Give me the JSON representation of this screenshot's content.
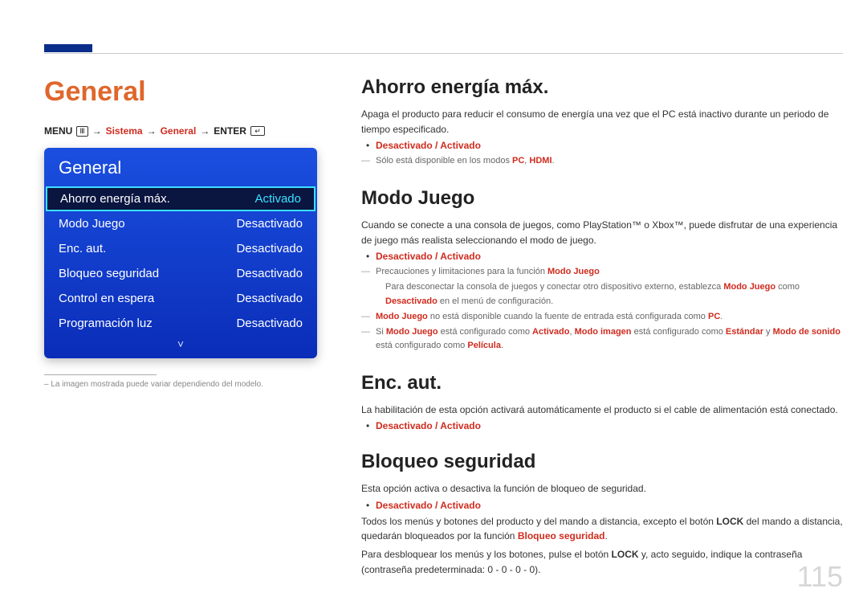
{
  "page": {
    "title": "General",
    "number": "115",
    "footnote": "La imagen mostrada puede variar dependiendo del modelo."
  },
  "breadcrumb": {
    "menu": "MENU",
    "arrow": "→",
    "sistema": "Sistema",
    "general": "General",
    "enter": "ENTER"
  },
  "osd": {
    "title": "General",
    "rows": [
      {
        "label": "Ahorro energía máx.",
        "value": "Activado",
        "selected": true
      },
      {
        "label": "Modo Juego",
        "value": "Desactivado",
        "selected": false
      },
      {
        "label": "Enc. aut.",
        "value": "Desactivado",
        "selected": false
      },
      {
        "label": "Bloqueo seguridad",
        "value": "Desactivado",
        "selected": false
      },
      {
        "label": "Control en espera",
        "value": "Desactivado",
        "selected": false
      },
      {
        "label": "Programación luz",
        "value": "Desactivado",
        "selected": false
      }
    ],
    "more": "˅"
  },
  "sections": {
    "ahorro": {
      "heading": "Ahorro energía máx.",
      "desc": "Apaga el producto para reducir el consumo de energía una vez que el PC está inactivo durante un periodo de tiempo especificado.",
      "options": "Desactivado / Activado",
      "note_prefix": "Sólo está disponible en los modos ",
      "note_pc": "PC",
      "note_sep": ", ",
      "note_hdmi": "HDMI",
      "note_suffix": "."
    },
    "modojuego": {
      "heading": "Modo Juego",
      "desc": "Cuando se conecte a una consola de juegos, como PlayStation™ o Xbox™, puede disfrutar de una experiencia de juego más realista seleccionando el modo de juego.",
      "options": "Desactivado / Activado",
      "note1_pre": "Precauciones y limitaciones para la función ",
      "note1_b": "Modo Juego",
      "sub1_pre": "Para desconectar la consola de juegos y conectar otro dispositivo externo, establezca ",
      "sub1_b1": "Modo Juego",
      "sub1_mid": " como ",
      "sub1_b2": "Desactivado",
      "sub1_post": " en el menú de configuración.",
      "note2_b1": "Modo Juego",
      "note2_mid": " no está disponible cuando la fuente de entrada está configurada como ",
      "note2_b2": "PC",
      "note2_post": ".",
      "note3_pre": "Si ",
      "note3_b1": "Modo Juego",
      "note3_m1": " está configurado como ",
      "note3_b2": "Activado",
      "note3_m2": ", ",
      "note3_b3": "Modo imagen",
      "note3_m3": " está configurado como ",
      "note3_b4": "Estándar",
      "note3_m4": " y ",
      "note3_b5": "Modo de sonido",
      "note3_m5": " está configurado como ",
      "note3_b6": "Película",
      "note3_post": "."
    },
    "encaut": {
      "heading": "Enc. aut.",
      "desc": "La habilitación de esta opción activará automáticamente el producto si el cable de alimentación está conectado.",
      "options": "Desactivado / Activado"
    },
    "bloqueo": {
      "heading": "Bloqueo seguridad",
      "desc": "Esta opción activa o desactiva la función de bloqueo de seguridad.",
      "options": "Desactivado / Activado",
      "p2_pre": "Todos los menús y botones del producto y del mando a distancia, excepto el botón ",
      "p2_b1": "LOCK",
      "p2_mid": " del mando a distancia, quedarán bloqueados por la función ",
      "p2_b2": "Bloqueo seguridad",
      "p2_post": ".",
      "p3_pre": "Para desbloquear los menús y los botones, pulse el botón ",
      "p3_b1": "LOCK",
      "p3_post": " y, acto seguido, indique la contraseña (contraseña predeterminada: 0 - 0 - 0 - 0)."
    }
  }
}
